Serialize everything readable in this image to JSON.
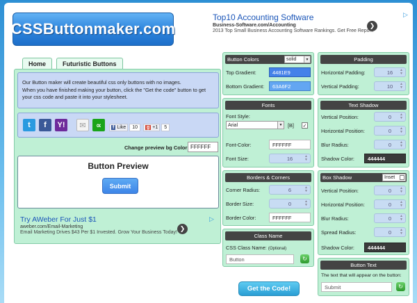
{
  "logo": "CSSButtonmaker.com",
  "ad_top": {
    "title": "Top10 Accounting Software",
    "url": "Business-Software.com/Accounting",
    "desc": "2013 Top Small Business Accounting Software Rankings. Get Free Report."
  },
  "tabs": [
    "Home",
    "Futuristic Buttons"
  ],
  "intro": {
    "line1": "Our Button maker will create beautiful css only buttons with no images.",
    "line2": "When you have finished making your button, click the \"Get the code\" button to get your css code and paste it into your stylesheet."
  },
  "share": {
    "like_label": "Like",
    "like_count": "10",
    "plus_label": "+1",
    "plus_count": "5"
  },
  "preview_bg": {
    "label": "Change preview bg Color:",
    "value": "FFFFFF"
  },
  "preview": {
    "title": "Button Preview",
    "button_label": "Submit"
  },
  "ad_left": {
    "title": "Try AWeber For Just $1",
    "url": "aweber.com/Email-Marketing",
    "desc": "Email Marketing Drives $43 Per $1 Invested. Grow Your Business Today!"
  },
  "button_colors": {
    "title": "Button Colors",
    "mode": "solid",
    "top_label": "Top Gradient:",
    "top_value": "4481E9",
    "bottom_label": "Bottom Gradient:",
    "bottom_value": "63A6F2"
  },
  "fonts": {
    "title": "Fonts",
    "style_label": "Font Style:",
    "style_value": "Arial",
    "bold_label": "[B]",
    "color_label": "Font-Color:",
    "color_value": "FFFFFF",
    "size_label": "Font Size:",
    "size_value": "16"
  },
  "borders": {
    "title": "Borders & Corners",
    "radius_label": "Corner Radius:",
    "radius_value": "6",
    "size_label": "Border Size:",
    "size_value": "0",
    "color_label": "Border Color:",
    "color_value": "FFFFFF"
  },
  "class_name": {
    "title": "Class Name",
    "label": "CSS Class Name:",
    "optional": "(Optional)",
    "placeholder": "Button"
  },
  "padding": {
    "title": "Padding",
    "h_label": "Horizontal Padding:",
    "h_value": "16",
    "v_label": "Vertical Padding:",
    "v_value": "10"
  },
  "text_shadow": {
    "title": "Text Shadow",
    "vpos_label": "Vertical Position:",
    "vpos_value": "0",
    "hpos_label": "Horizontal Position:",
    "hpos_value": "0",
    "blur_label": "Blur Radius:",
    "blur_value": "0",
    "color_label": "Shadow Color:",
    "color_value": "444444"
  },
  "box_shadow": {
    "title": "Box Shadow",
    "inset_label": "Inset",
    "vpos_label": "Vertical Position:",
    "vpos_value": "0",
    "hpos_label": "Horizontal Position:",
    "hpos_value": "0",
    "blur_label": "Blur Radius:",
    "blur_value": "0",
    "spread_label": "Spread Radius:",
    "spread_value": "0",
    "color_label": "Shadow Color:",
    "color_value": "444444"
  },
  "button_text": {
    "title": "Button Text",
    "label": "The text that will appear on the button:",
    "placeholder": "Submit"
  },
  "get_code": "Get the Code!",
  "colors": {
    "accent": "#4481E9",
    "panel": "#BFF0D5",
    "header_dark": "#444444"
  }
}
